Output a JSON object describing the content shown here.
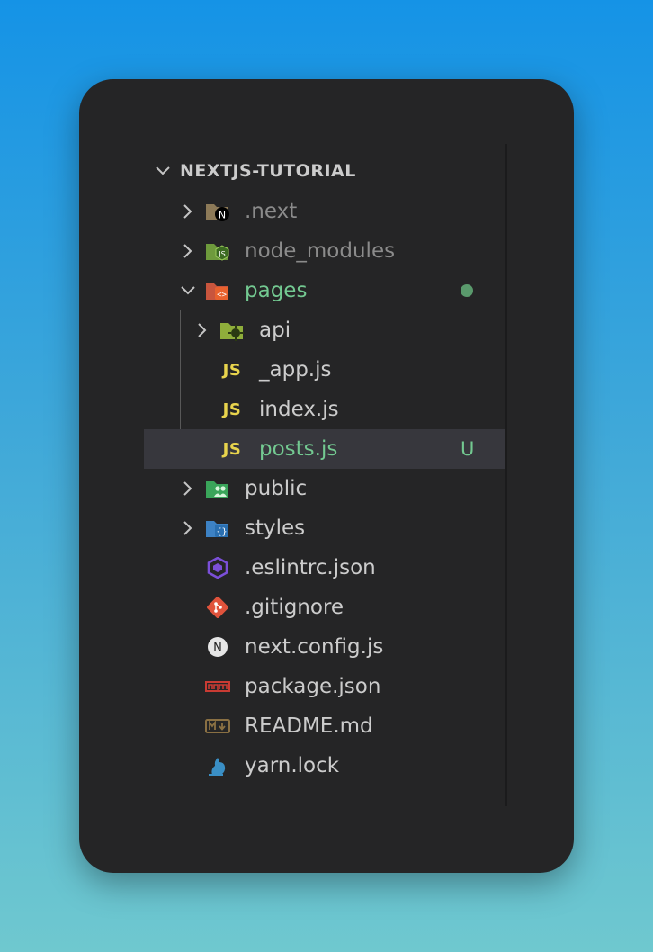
{
  "explorer": {
    "root": {
      "label": "NEXTJS-TUTORIAL",
      "expanded": true
    },
    "items": [
      {
        "label": ".next",
        "icon": "nextjs-folder-icon",
        "type": "folder",
        "expanded": false,
        "dimmed": true
      },
      {
        "label": "node_modules",
        "icon": "node-folder-icon",
        "type": "folder",
        "expanded": false,
        "dimmed": true
      },
      {
        "label": "pages",
        "icon": "pages-folder-icon",
        "type": "folder",
        "expanded": true,
        "git_status": "modified-dot"
      },
      {
        "label": "api",
        "icon": "api-folder-icon",
        "type": "folder",
        "expanded": false
      },
      {
        "label": "_app.js",
        "icon": "javascript-file-icon",
        "icon_text": "JS",
        "type": "file"
      },
      {
        "label": "index.js",
        "icon": "javascript-file-icon",
        "icon_text": "JS",
        "type": "file"
      },
      {
        "label": "posts.js",
        "icon": "javascript-file-icon",
        "icon_text": "JS",
        "type": "file",
        "selected": true,
        "git_status": "U"
      },
      {
        "label": "public",
        "icon": "public-folder-icon",
        "type": "folder",
        "expanded": false
      },
      {
        "label": "styles",
        "icon": "styles-folder-icon",
        "type": "folder",
        "expanded": false
      },
      {
        "label": ".eslintrc.json",
        "icon": "eslint-icon",
        "type": "file"
      },
      {
        "label": ".gitignore",
        "icon": "git-icon",
        "type": "file"
      },
      {
        "label": "next.config.js",
        "icon": "nextjs-icon",
        "type": "file"
      },
      {
        "label": "package.json",
        "icon": "npm-icon",
        "type": "file"
      },
      {
        "label": "README.md",
        "icon": "markdown-icon",
        "type": "file"
      },
      {
        "label": "yarn.lock",
        "icon": "yarn-icon",
        "type": "file"
      }
    ]
  },
  "colors": {
    "background_top": "#1593e6",
    "background_bottom": "#6fc8cf",
    "panel": "#252526",
    "selected_row": "#37373d",
    "text": "#cccccc",
    "dimmed_text": "#8b8b8b",
    "git_untracked": "#73c991",
    "js_yellow": "#e8d44d"
  }
}
